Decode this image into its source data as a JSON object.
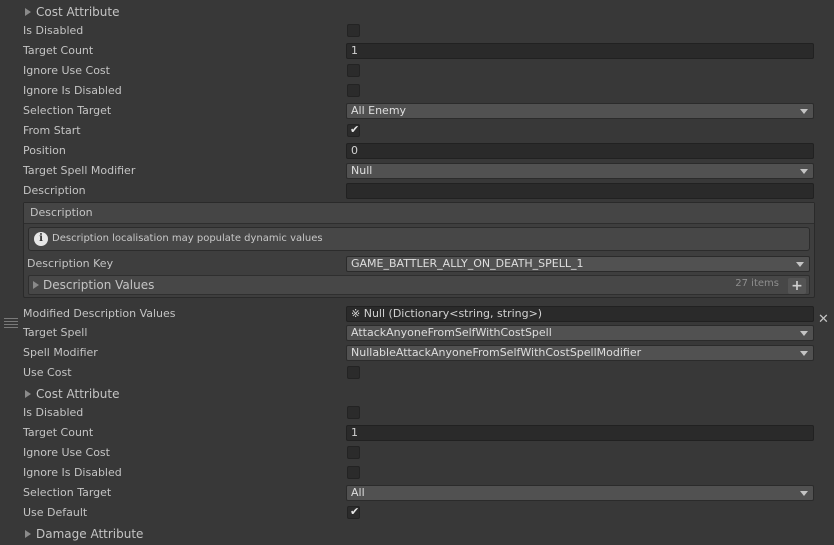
{
  "rows": {
    "cost_attr_1": "Cost Attribute",
    "is_disabled_1": "Is Disabled",
    "target_count_1": "Target Count",
    "target_count_1_value": "1",
    "ignore_use_cost_1": "Ignore Use Cost",
    "ignore_is_disabled_1": "Ignore Is Disabled",
    "selection_target_1": "Selection Target",
    "selection_target_1_value": "All Enemy",
    "from_start": "From Start",
    "position": "Position",
    "position_value": "0",
    "target_spell_modifier": "Target Spell Modifier",
    "target_spell_modifier_value": "Null",
    "description": "Description",
    "description_value": ""
  },
  "description_panel": {
    "title": "Description",
    "info_text": "Description localisation may populate dynamic values",
    "key_label": "Description Key",
    "key_value": "GAME_BATTLER_ALLY_ON_DEATH_SPELL_1",
    "values_label": "Description Values",
    "values_count": "27 items",
    "add_symbol": "+"
  },
  "rows2": {
    "modified_desc_values": "Modified Description Values",
    "modified_desc_values_value": "※ Null (Dictionary<string, string>)",
    "close_symbol": "✕",
    "target_spell": "Target Spell",
    "target_spell_value": "AttackAnyoneFromSelfWithCostSpell",
    "spell_modifier": "Spell Modifier",
    "spell_modifier_value": "NullableAttackAnyoneFromSelfWithCostSpellModifier",
    "use_cost": "Use Cost",
    "cost_attr_2": "Cost Attribute",
    "is_disabled_2": "Is Disabled",
    "target_count_2": "Target Count",
    "target_count_2_value": "1",
    "ignore_use_cost_2": "Ignore Use Cost",
    "ignore_is_disabled_2": "Ignore Is Disabled",
    "selection_target_2": "Selection Target",
    "selection_target_2_value": "All",
    "use_default": "Use Default",
    "damage_attr": "Damage Attribute"
  },
  "checkbox_states": {
    "is_disabled_1": false,
    "ignore_use_cost_1": false,
    "ignore_is_disabled_1": false,
    "from_start": true,
    "use_cost": false,
    "is_disabled_2": false,
    "ignore_use_cost_2": false,
    "ignore_is_disabled_2": false,
    "use_default": true
  },
  "icons": {
    "fold": "triangle-right-icon",
    "dropdown": "chevron-down-icon",
    "check": "checkmark-icon",
    "info": "info-icon",
    "check_glyph": "✔",
    "info_glyph": "i"
  },
  "colors": {
    "background": "#383838",
    "text": "#c4c4c4",
    "field": "#2a2a2a",
    "dropdown": "#515151"
  }
}
